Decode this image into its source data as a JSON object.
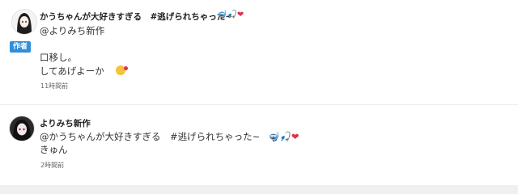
{
  "comments": [
    {
      "author_name": "かうちゃんが大好きすぎる　#逃げられちゃった~",
      "name_emojis": "🤿🎣",
      "heart": "❤",
      "badge": "作者",
      "mention": "@よりみち新作",
      "lines": [
        "口移し。",
        "してあげよーか"
      ],
      "reaction_icon": "face-blowing-kiss-icon",
      "time": "11時間前"
    },
    {
      "author_name": "よりみち新作",
      "mention_text": "@かうちゃんが大好きすぎる　#逃げられちゃった~",
      "mention_emojis": "🤿🎣",
      "heart": "❤",
      "lines": [
        "きゅん"
      ],
      "time": "2時間前"
    }
  ],
  "colors": {
    "badge": "#2f8fd8",
    "heart": "#e0304e",
    "divider": "#ececec"
  }
}
